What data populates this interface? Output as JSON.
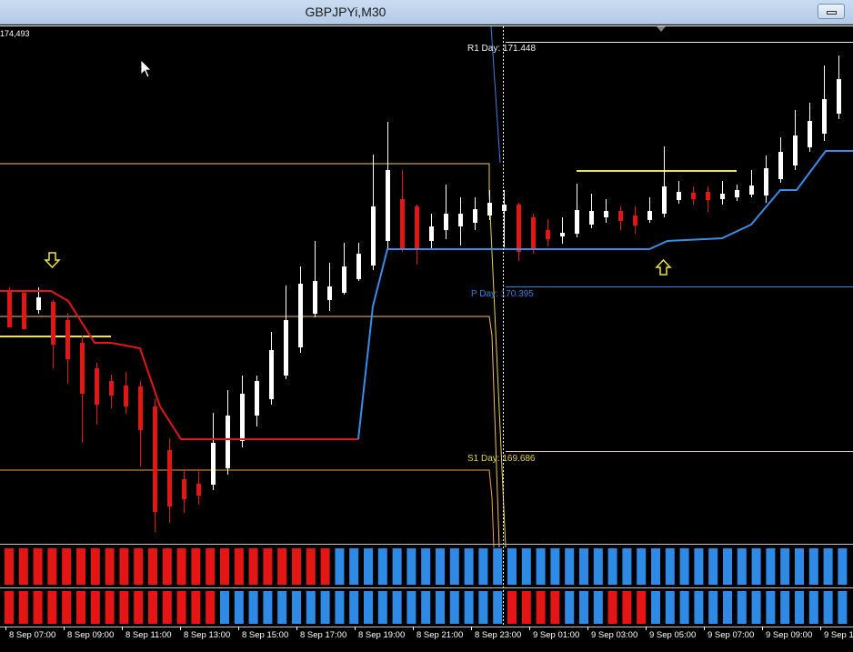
{
  "window": {
    "title": "GBPJPYi,M30"
  },
  "chart": {
    "price_label": "174,493",
    "pivots": {
      "r1": "R1 Day: 171.448",
      "p": "P Day: 170.395",
      "s1": "S1 Day: 169.686"
    },
    "time_labels": [
      "8 Sep 07:00",
      "8 Sep 09:00",
      "8 Sep 11:00",
      "8 Sep 13:00",
      "8 Sep 15:00",
      "8 Sep 17:00",
      "8 Sep 19:00",
      "8 Sep 21:00",
      "8 Sep 23:00",
      "9 Sep 01:00",
      "9 Sep 03:00",
      "9 Sep 05:00",
      "9 Sep 07:00",
      "9 Sep 09:00",
      "9 Sep 1"
    ],
    "colors": {
      "bull": "#ffffff",
      "bear": "#e31515",
      "trail_bear": "#e31515",
      "trail_bull": "#3b8ce8",
      "pivot_r1": "#f0f0f0",
      "pivot_p": "#3b7ee0",
      "pivot_s1": "#e6d24a",
      "yellow": "#f2e33c",
      "orange": "#f0a050",
      "hist_red": "#e31515",
      "hist_blue": "#2f8ae6",
      "background": "#000000",
      "grid_text": "#ffffff"
    }
  }
}
